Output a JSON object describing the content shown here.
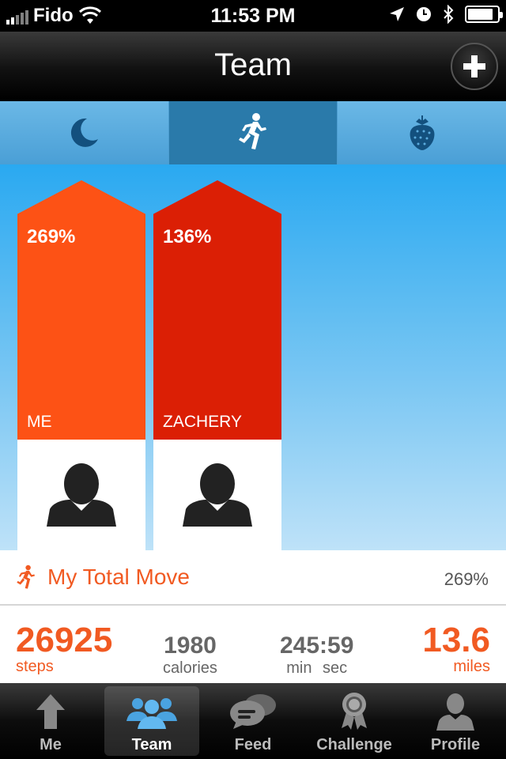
{
  "status_bar": {
    "carrier": "Fido",
    "time": "11:53 PM"
  },
  "nav": {
    "title": "Team",
    "add_icon": "plus-icon"
  },
  "segments": [
    {
      "icon": "moon-icon",
      "active": false
    },
    {
      "icon": "running-icon",
      "active": true
    },
    {
      "icon": "strawberry-icon",
      "active": false
    }
  ],
  "members": [
    {
      "name": "ME",
      "percent": "269%",
      "progress_pct": 269,
      "color": "#fd5215"
    },
    {
      "name": "ZACHERY",
      "percent": "136%",
      "progress_pct": 136,
      "color": "#db1f05"
    }
  ],
  "total_move": {
    "title": "My Total Move",
    "percent": "269%",
    "steps": {
      "value": "26925",
      "unit": "steps"
    },
    "calories": {
      "value": "1980",
      "unit": "calories"
    },
    "time": {
      "value": "245:59",
      "unit": "min sec"
    },
    "distance": {
      "value": "13.6",
      "unit": "miles"
    }
  },
  "tabs": [
    {
      "label": "Me",
      "icon": "up-arrow-icon",
      "active": false
    },
    {
      "label": "Team",
      "icon": "team-icon",
      "active": true
    },
    {
      "label": "Feed",
      "icon": "chat-bubbles-icon",
      "active": false
    },
    {
      "label": "Challenge",
      "icon": "award-ribbon-icon",
      "active": false
    },
    {
      "label": "Profile",
      "icon": "person-icon",
      "active": false
    }
  ],
  "colors": {
    "accent": "#f15a22",
    "me_bar": "#fd5215",
    "zachery_bar": "#db1f05"
  }
}
